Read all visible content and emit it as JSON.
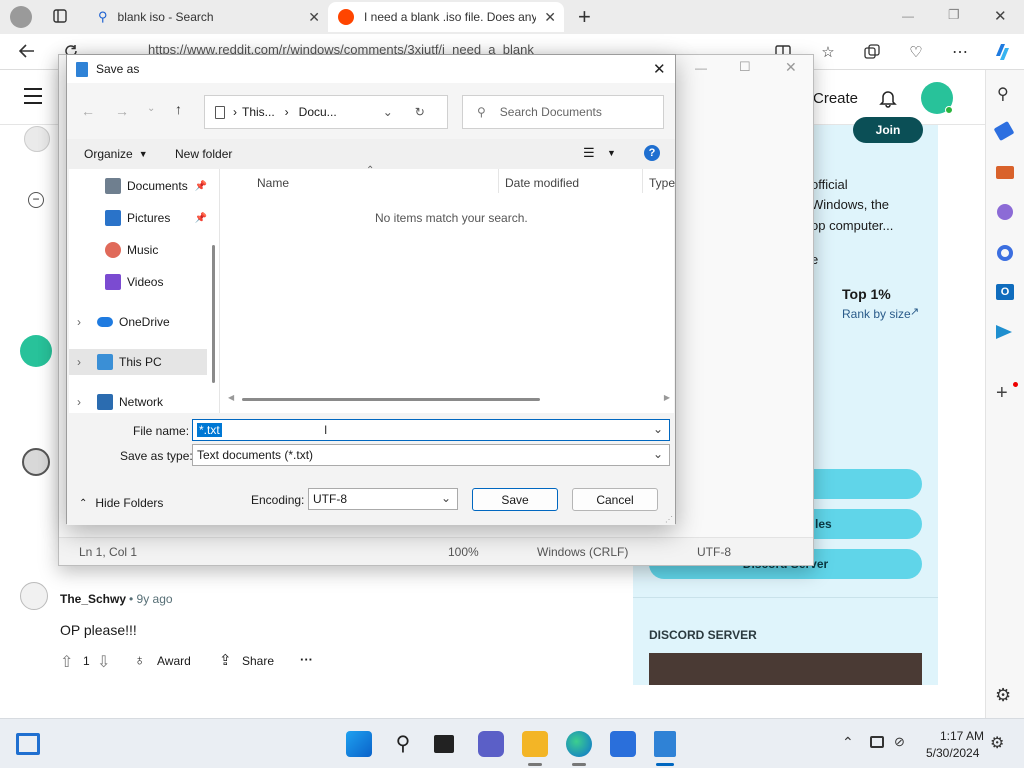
{
  "browser": {
    "tabs": [
      {
        "label": "blank iso - Search",
        "close": "✕"
      },
      {
        "label": "I need a blank .iso file. Does anyo",
        "close": "✕"
      }
    ],
    "new_tab": "+",
    "url": "https://www.reddit.com/r/windows/comments/3xiutf/i_need_a_blank",
    "window_controls": {
      "minimize": "—",
      "restore": "❐",
      "close": "✕"
    }
  },
  "reddit": {
    "header": {
      "create_label": "Create"
    },
    "sidebar": {
      "join_label": "Join",
      "description": [
        "official",
        "Windows, the",
        "op computer...",
        "e"
      ],
      "rank_value": "Top 1%",
      "rank_label": "Rank by size",
      "pill_buttons": [
        "",
        "les",
        "Discord Server"
      ],
      "discord_heading": "DISCORD SERVER"
    },
    "comment": {
      "author": "The_Schwy",
      "age": "• 9y ago",
      "text": "OP please!!!",
      "votes": "1",
      "award_label": "Award",
      "share_label": "Share",
      "more_label": "···"
    }
  },
  "notepad": {
    "status": {
      "position": "Ln 1, Col 1",
      "zoom": "100%",
      "line_ending": "Windows (CRLF)",
      "encoding": "UTF-8"
    },
    "controls": {
      "minimize": "—",
      "maximize": "☐",
      "close": "✕"
    }
  },
  "dialog": {
    "title": "Save as",
    "close": "✕",
    "breadcrumb": [
      "This...",
      "Docu..."
    ],
    "search_placeholder": "Search Documents",
    "organize_label": "Organize",
    "new_folder_label": "New folder",
    "nav_items": [
      {
        "label": "Documents",
        "pinned": true,
        "color": "#6f7f8f"
      },
      {
        "label": "Pictures",
        "pinned": true,
        "color": "#2a73c9"
      },
      {
        "label": "Music",
        "pinned": false,
        "color": "#e06a5a"
      },
      {
        "label": "Videos",
        "pinned": false,
        "color": "#7b4bd1"
      },
      {
        "label": "OneDrive",
        "pinned": false,
        "color": "#1f7be0"
      },
      {
        "label": "This PC",
        "pinned": false,
        "color": "#3a8fd6"
      },
      {
        "label": "Network",
        "pinned": false,
        "color": "#2b6cb0"
      }
    ],
    "columns": [
      "Name",
      "Date modified",
      "Type"
    ],
    "empty_message": "No items match your search.",
    "file_name_label": "File name:",
    "file_name_value": "*.txt",
    "save_type_label": "Save as type:",
    "save_type_value": "Text documents (*.txt)",
    "hide_folders_label": "Hide Folders",
    "encoding_label": "Encoding:",
    "encoding_value": "UTF-8",
    "save_label": "Save",
    "cancel_label": "Cancel"
  },
  "taskbar": {
    "time": "1:17 AM",
    "date": "5/30/2024"
  },
  "colors": {
    "accent": "#0067c0",
    "reddit_panel": "#dff4fb",
    "pill": "#60d5e9",
    "selection": "#0078d4"
  }
}
